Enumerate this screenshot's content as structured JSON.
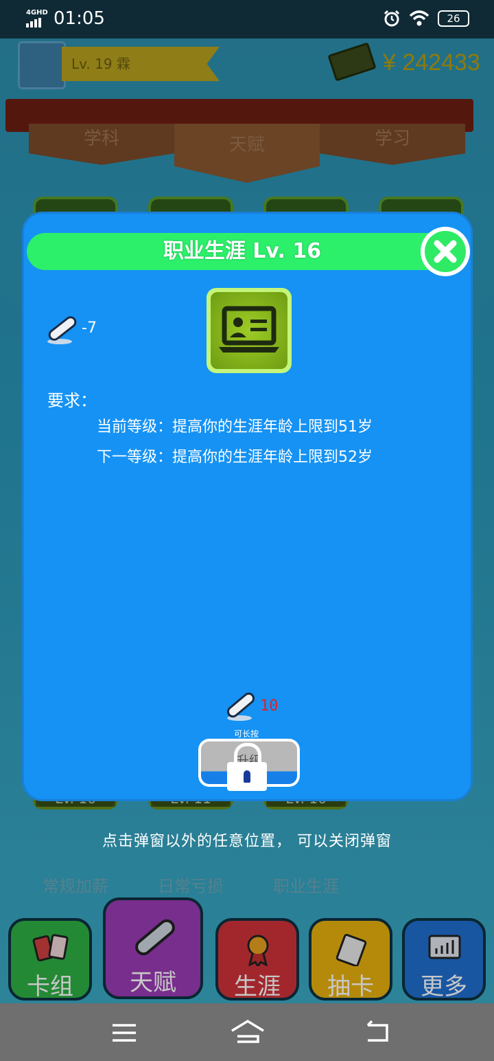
{
  "status_bar": {
    "network": "4GHD",
    "time": "01:05",
    "battery": "26"
  },
  "header": {
    "level_name": "Lv. 19 霖",
    "money": "¥ 242433"
  },
  "tabs": [
    {
      "label": "学科"
    },
    {
      "label": "天赋"
    },
    {
      "label": "学习"
    }
  ],
  "cards": [
    {
      "level": "Lv. 16",
      "name": "常规加薪"
    },
    {
      "level": "Lv. 11",
      "name": "日常亏损"
    },
    {
      "level": "Lv. 16",
      "name": "职业生涯"
    }
  ],
  "hint": "点击弹窗以外的任意位置， 可以关闭弹窗",
  "nav": [
    {
      "label": "卡组",
      "color": "#2fb044"
    },
    {
      "label": "天赋",
      "color": "#9a3bb5"
    },
    {
      "label": "生涯",
      "color": "#d0323a"
    },
    {
      "label": "抽卡",
      "color": "#e8b10f"
    },
    {
      "label": "更多",
      "color": "#1f6fd0"
    }
  ],
  "modal": {
    "title": "职业生涯  Lv. 16",
    "cost": "-7",
    "requirements_label": "要求：",
    "current_level_text": "当前等级：提高你的生涯年龄上限到51岁",
    "next_level_text": "下一等级：提高你的生涯年龄上限到52岁",
    "scroll_count": "10",
    "long_press_label": "可长按",
    "upgrade_label": "升级",
    "accent_color": "#2cef6a",
    "background_color": "#1592f4"
  }
}
